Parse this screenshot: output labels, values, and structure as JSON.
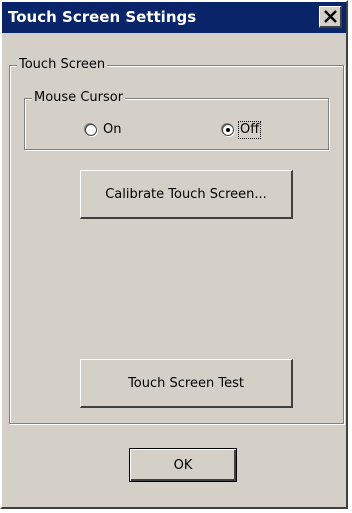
{
  "window": {
    "title": "Touch Screen Settings"
  },
  "touch_screen_group": {
    "label": "Touch Screen"
  },
  "mouse_cursor_group": {
    "label": "Mouse Cursor",
    "options": [
      {
        "label": "On",
        "selected": false
      },
      {
        "label": "Off",
        "selected": true
      }
    ]
  },
  "buttons": {
    "calibrate": "Calibrate Touch Screen...",
    "test": "Touch Screen Test",
    "ok": "OK"
  },
  "icons": {
    "close": "close-icon"
  },
  "colors": {
    "titlebar": "#0a246a",
    "face": "#d4d0c8",
    "title_text": "#ffffff"
  }
}
